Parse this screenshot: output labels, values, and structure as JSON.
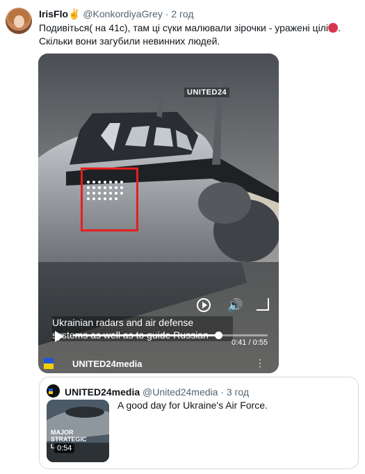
{
  "tweet": {
    "author_name": "IrisFlo✌",
    "handle": "@KonkordiyaGrey",
    "separator": "·",
    "time": "2 год",
    "text_line1": "Подивіться( на 41с), там ці сүки малювали зірочки - уражені цілі",
    "text_line1_end": ".",
    "text_line2": "Скільки вони загубили невинних людей."
  },
  "video": {
    "watermark": "UNITED24",
    "subtitle_line1": "Ukrainian radars and air defense",
    "subtitle_line2": "systems as well as to guide Russian",
    "current_time": "0:41",
    "separator": "/",
    "total_time": "0:55",
    "progress_fraction": 0.745,
    "channel_name": "UNITED24media",
    "more_label": "⋮"
  },
  "quote": {
    "author_name": "UNITED24media",
    "handle": "@United24media",
    "separator": "·",
    "time": "3 год",
    "text": "A good day for Ukraine's Air Force.",
    "thumb_title": "MAJOR STRATEGIC L…",
    "thumb_duration": "0:54"
  },
  "colors": {
    "red_box": "#e51f1f",
    "flag_blue": "#2157d6",
    "flag_yellow": "#f4d000"
  }
}
